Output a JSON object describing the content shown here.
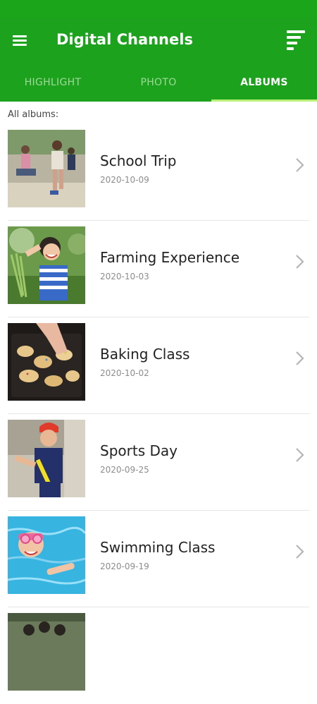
{
  "app": {
    "title": "Digital Channels",
    "brand_color": "#1ca21c",
    "accent_color": "#b8f078"
  },
  "header": {
    "menu_icon": "hamburger-menu-icon",
    "sort_icon": "sort-icon"
  },
  "tabs": [
    {
      "label": "HIGHLIGHT",
      "active": false
    },
    {
      "label": "PHOTO",
      "active": false
    },
    {
      "label": "ALBUMS",
      "active": true
    }
  ],
  "section_label": "All albums:",
  "albums": [
    {
      "title": "School Trip",
      "date": "2020-10-09"
    },
    {
      "title": "Farming Experience",
      "date": "2020-10-03"
    },
    {
      "title": "Baking Class",
      "date": "2020-10-02"
    },
    {
      "title": "Sports Day",
      "date": "2020-09-25"
    },
    {
      "title": "Swimming Class",
      "date": "2020-09-19"
    }
  ]
}
